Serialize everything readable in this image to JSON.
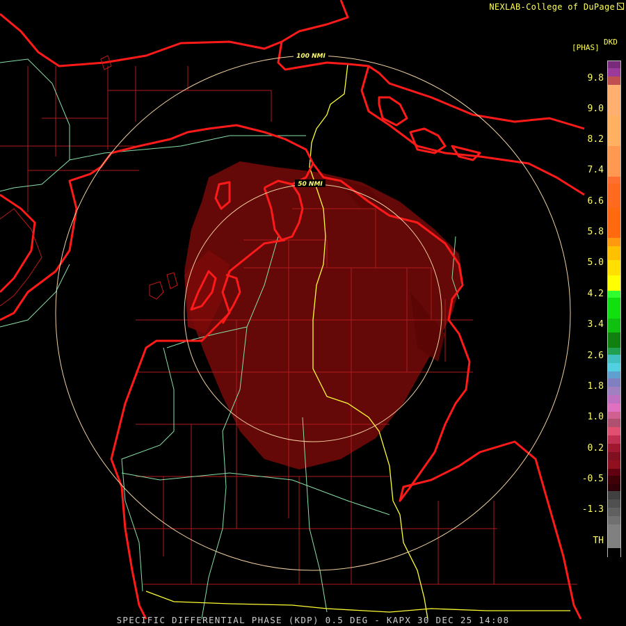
{
  "header": {
    "credit": "NEXLAB-College of DuPage"
  },
  "legend": {
    "product": "DKD",
    "unit": "[PHAS]",
    "ticks": [
      "9.8",
      "9.0",
      "8.2",
      "7.4",
      "6.6",
      "5.8",
      "5.0",
      "4.2",
      "3.4",
      "2.6",
      "1.8",
      "1.0",
      "0.2",
      "-0.5",
      "-1.3",
      "TH"
    ]
  },
  "range_rings": {
    "inner": "50 NMI",
    "outer": "100 NMI"
  },
  "footer": {
    "caption": "SPECIFIC DIFFERENTIAL PHASE (KDP) 0.5 DEG - KAPX 30 DEC 25 14:08"
  },
  "colors": {
    "coastline": "#ff1a1a",
    "county_lines": "#c02020",
    "roads": "#ffff33",
    "secondary_roads": "#88e0a8",
    "rings": "#f0d0a0",
    "echo": "#6a0808",
    "label": "#ffff66"
  }
}
